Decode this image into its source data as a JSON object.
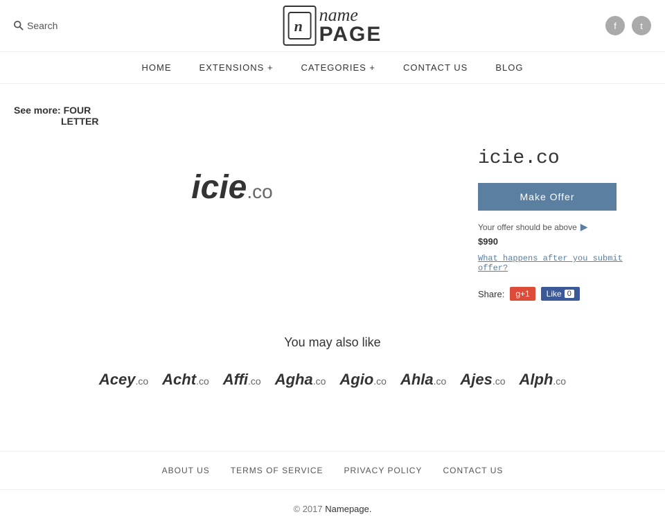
{
  "header": {
    "search_label": "Search",
    "logo_icon_char": "n",
    "logo_name": "name",
    "logo_page": "PAGE",
    "social": [
      {
        "name": "facebook",
        "char": "f"
      },
      {
        "name": "twitter",
        "char": "t"
      }
    ]
  },
  "nav": {
    "items": [
      {
        "label": "HOME",
        "id": "home"
      },
      {
        "label": "EXTENSIONS +",
        "id": "extensions"
      },
      {
        "label": "CATEGORIES +",
        "id": "categories"
      },
      {
        "label": "CONTACT US",
        "id": "contact"
      },
      {
        "label": "BLOG",
        "id": "blog"
      }
    ]
  },
  "breadcrumb": {
    "see_more_label": "See more:",
    "line1": "FOUR",
    "line2": "LETTER"
  },
  "product": {
    "domain_name": "icie",
    "domain_tld": ".co",
    "title": "icie.co",
    "make_offer_label": "Make Offer",
    "offer_hint": "Your offer should be above",
    "offer_price": "$990",
    "what_happens_label": "What happens after you submit offer?",
    "share_label": "Share:",
    "gplus_label": "g+1",
    "fb_label": "Like",
    "fb_count": "0"
  },
  "also_like": {
    "title": "You may also like",
    "items": [
      {
        "name": "Acey",
        "tld": ".co"
      },
      {
        "name": "Acht",
        "tld": ".co"
      },
      {
        "name": "Affi",
        "tld": ".co"
      },
      {
        "name": "Agha",
        "tld": ".co"
      },
      {
        "name": "Agio",
        "tld": ".co"
      },
      {
        "name": "Ahla",
        "tld": ".co"
      },
      {
        "name": "Ajes",
        "tld": ".co"
      },
      {
        "name": "Alph",
        "tld": ".co"
      }
    ]
  },
  "footer": {
    "nav_items": [
      {
        "label": "ABOUT US",
        "id": "about"
      },
      {
        "label": "TERMS OF SERVICE",
        "id": "terms"
      },
      {
        "label": "PRIVACY POLICY",
        "id": "privacy"
      },
      {
        "label": "CONTACT US",
        "id": "contact"
      }
    ],
    "copyright": "© 2017",
    "brand": "Namepage."
  }
}
